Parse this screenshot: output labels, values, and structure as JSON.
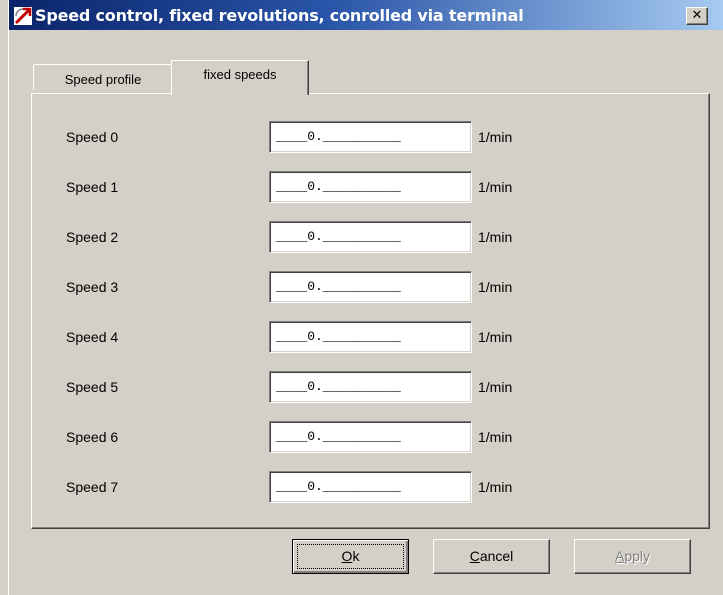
{
  "window": {
    "title": "Speed control, fixed revolutions, conrolled via terminal",
    "close_glyph": "✕",
    "icon": "app-speed-icon"
  },
  "tabs": [
    {
      "label": "Speed profile",
      "active": false
    },
    {
      "label": "fixed speeds",
      "active": true
    }
  ],
  "speeds": [
    {
      "label": "Speed 0",
      "value": "____0.__________",
      "unit": "1/min"
    },
    {
      "label": "Speed 1",
      "value": "____0.__________",
      "unit": "1/min"
    },
    {
      "label": "Speed 2",
      "value": "____0.__________",
      "unit": "1/min"
    },
    {
      "label": "Speed 3",
      "value": "____0.__________",
      "unit": "1/min"
    },
    {
      "label": "Speed 4",
      "value": "____0.__________",
      "unit": "1/min"
    },
    {
      "label": "Speed 5",
      "value": "____0.__________",
      "unit": "1/min"
    },
    {
      "label": "Speed 6",
      "value": "____0.__________",
      "unit": "1/min"
    },
    {
      "label": "Speed 7",
      "value": "____0.__________",
      "unit": "1/min"
    }
  ],
  "buttons": {
    "ok": {
      "mnemonic": "O",
      "rest": "k"
    },
    "cancel": {
      "mnemonic": "C",
      "rest": "ancel"
    },
    "apply": {
      "mnemonic": "A",
      "rest": "pply",
      "enabled": false
    }
  },
  "colors": {
    "titlebar_start": "#0a246a",
    "titlebar_end": "#a6caf0",
    "face": "#d4d0c8"
  }
}
